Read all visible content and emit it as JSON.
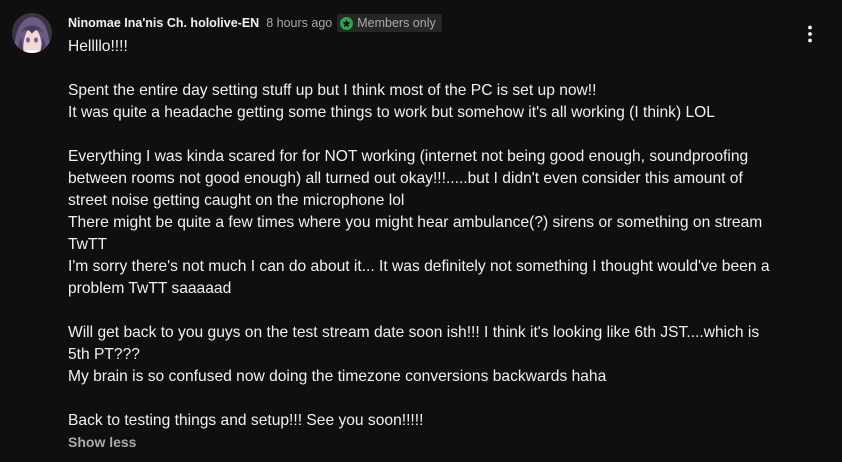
{
  "post": {
    "author": "Ninomae Ina'nis Ch. hololive-EN",
    "time": "8 hours ago",
    "badge": "Members only",
    "lines": [
      "Hellllo!!!!",
      "",
      "Spent the entire day setting stuff up but I think most of the PC is set up now!!",
      "It was quite a headache getting some things to work but somehow it's all working (I think) LOL",
      "",
      "Everything I was kinda scared for for NOT working (internet not being good enough, soundproofing",
      "between rooms not good enough) all turned out okay!!!.....but I didn't even consider this amount of",
      "street noise getting caught on the microphone lol",
      "There might be quite a few times where you might hear ambulance(?) sirens or something on stream",
      "TwTT",
      "I'm sorry there's not much I can do about it... It was definitely not something I thought would've been a",
      "problem  TwTT saaaaad",
      "",
      "Will get back to you guys on the test stream date soon ish!!! I think it's looking like 6th JST....which is",
      "5th PT???",
      "My brain is so confused now doing the timezone conversions backwards haha",
      "",
      "Back to testing things and setup!!! See you soon!!!!!"
    ],
    "show_less": "Show less"
  },
  "icons": {
    "avatar": "channel-avatar",
    "badge": "members-star-icon",
    "menu": "more-vert-icon"
  },
  "colors": {
    "background": "#0f0f0f",
    "text": "#f1f1f1",
    "secondary_text": "#aaaaaa",
    "badge_background": "#272727",
    "badge_icon": "#2ba640"
  }
}
